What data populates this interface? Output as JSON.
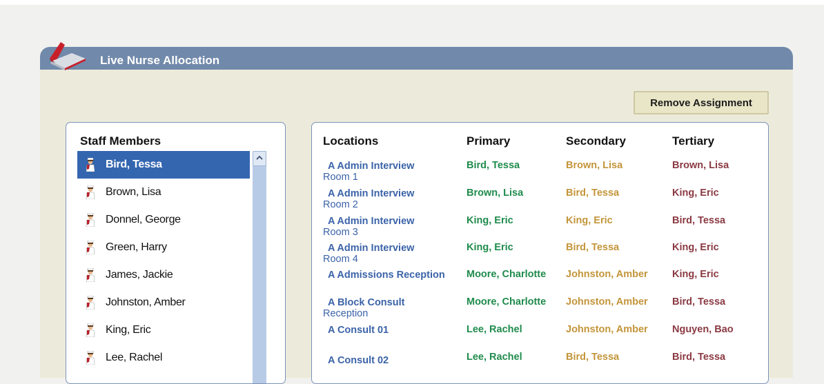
{
  "header": {
    "title": "Live Nurse Allocation"
  },
  "toolbar": {
    "remove_label": "Remove Assignment"
  },
  "staff": {
    "title": "Staff Members",
    "items": [
      {
        "name": "Bird, Tessa",
        "selected": true
      },
      {
        "name": "Brown, Lisa"
      },
      {
        "name": "Donnel, George"
      },
      {
        "name": "Green, Harry"
      },
      {
        "name": "James, Jackie"
      },
      {
        "name": "Johnston, Amber"
      },
      {
        "name": "King, Eric"
      },
      {
        "name": "Lee, Rachel"
      }
    ]
  },
  "locations": {
    "headers": {
      "location": "Locations",
      "primary": "Primary",
      "secondary": "Secondary",
      "tertiary": "Tertiary"
    },
    "rows": [
      {
        "name1": "A Admin Interview",
        "name2": "Room 1",
        "primary": "Bird, Tessa",
        "secondary": "Brown, Lisa",
        "tertiary": "Brown, Lisa"
      },
      {
        "name1": "A Admin Interview",
        "name2": "Room 2",
        "primary": "Brown, Lisa",
        "secondary": "Bird, Tessa",
        "tertiary": "King, Eric"
      },
      {
        "name1": "A Admin Interview",
        "name2": "Room 3",
        "primary": "King, Eric",
        "secondary": "King, Eric",
        "tertiary": "Bird, Tessa"
      },
      {
        "name1": "A Admin Interview",
        "name2": "Room 4",
        "primary": "King, Eric",
        "secondary": "Bird, Tessa",
        "tertiary": "King, Eric"
      },
      {
        "name1": "A Admissions Reception",
        "name2": "",
        "primary": "Moore, Charlotte",
        "secondary": "Johnston, Amber",
        "tertiary": "King, Eric"
      },
      {
        "name1": "A Block Consult",
        "name2": "Reception",
        "primary": "Moore, Charlotte",
        "secondary": "Johnston, Amber",
        "tertiary": "Bird, Tessa"
      },
      {
        "name1": "A Consult 01",
        "name2": "",
        "primary": "Lee, Rachel",
        "secondary": "Johnston, Amber",
        "tertiary": "Nguyen, Bao"
      },
      {
        "name1": "A Consult 02",
        "name2": "",
        "primary": "Lee, Rachel",
        "secondary": "Bird, Tessa",
        "tertiary": "Bird, Tessa"
      }
    ]
  },
  "colors": {
    "header_bg": "#7189aa",
    "selected_bg": "#3466b0",
    "location_text": "#3b63a8",
    "primary_text": "#1f8b4c",
    "secondary_text": "#c3953a",
    "tertiary_text": "#8b3a43"
  },
  "icons": {
    "app": "book-icon",
    "staff": "nurse-icon",
    "scroll": "chevron-up-icon"
  }
}
